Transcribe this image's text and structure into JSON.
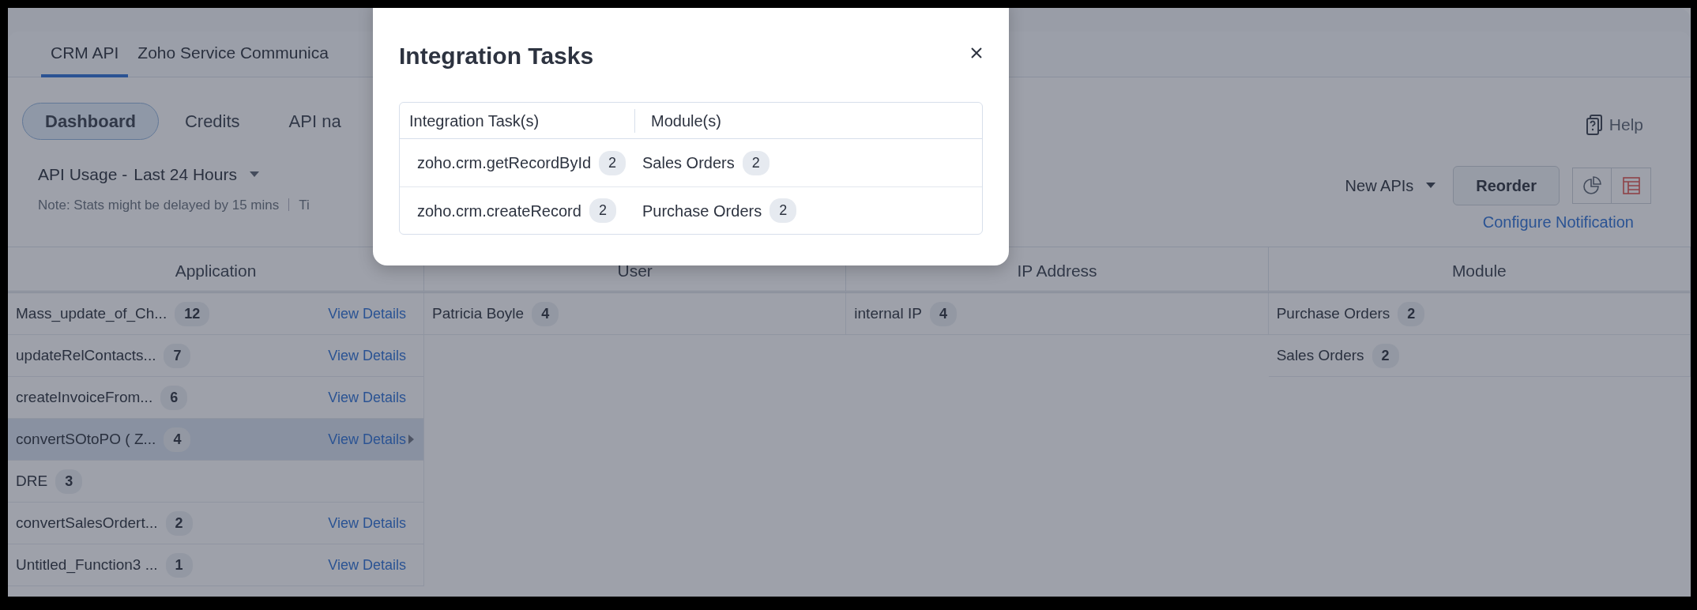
{
  "tabs": [
    {
      "label": "CRM API",
      "selected": true
    },
    {
      "label": "Zoho Service Communica",
      "selected": false
    }
  ],
  "sub_tabs": [
    {
      "label": "Dashboard",
      "selected": true
    },
    {
      "label": "Credits",
      "selected": false
    },
    {
      "label": "API na",
      "selected": false
    }
  ],
  "usage": {
    "label": "API Usage -",
    "period": "Last 24 Hours",
    "note": "Note: Stats might be delayed by 15 mins",
    "note_cut": "Ti"
  },
  "help": "Help",
  "toolbar": {
    "filter": "New APIs",
    "reorder": "Reorder",
    "configure": "Configure Notification",
    "views": [
      {
        "kind": "chart",
        "selected": false
      },
      {
        "kind": "table",
        "selected": true
      }
    ]
  },
  "table": {
    "columns": [
      "Application",
      "User",
      "IP Address",
      "Module"
    ],
    "applications": [
      {
        "name": "Mass_update_of_Ch...",
        "count": "12",
        "link": "View Details",
        "selected": false
      },
      {
        "name": "updateRelContacts...",
        "count": "7",
        "link": "View Details",
        "selected": false
      },
      {
        "name": "createInvoiceFrom...",
        "count": "6",
        "link": "View Details",
        "selected": false
      },
      {
        "name": "convertSOtoPO ( Z...",
        "count": "4",
        "link": "View Details",
        "selected": true
      },
      {
        "name": "DRE",
        "count": "3",
        "selected": false
      },
      {
        "name": "convertSalesOrdert...",
        "count": "2",
        "link": "View Details",
        "selected": false
      },
      {
        "name": "Untitled_Function3 ...",
        "count": "1",
        "link": "View Details",
        "selected": false
      }
    ],
    "users": [
      {
        "name": "Patricia Boyle",
        "count": "4"
      }
    ],
    "ip_addresses": [
      {
        "name": "internal IP",
        "count": "4"
      }
    ],
    "modules": [
      {
        "name": "Purchase Orders",
        "count": "2"
      },
      {
        "name": "Sales Orders",
        "count": "2"
      }
    ]
  },
  "modal": {
    "title": "Integration Tasks",
    "columns": [
      "Integration Task(s)",
      "Module(s)"
    ],
    "rows": [
      {
        "task": "zoho.crm.getRecordById",
        "task_count": "2",
        "module": "Sales Orders",
        "module_count": "2"
      },
      {
        "task": "zoho.crm.createRecord",
        "task_count": "2",
        "module": "Purchase Orders",
        "module_count": "2"
      }
    ]
  }
}
